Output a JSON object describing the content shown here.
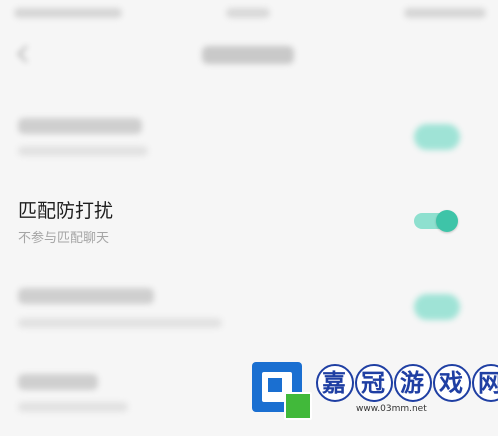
{
  "setting": {
    "title": "匹配防打扰",
    "subtitle": "不参与匹配聊天",
    "toggle_on": true
  },
  "colors": {
    "toggle_track": "#8ee0cf",
    "toggle_knob": "#3ec4a8",
    "background": "#f6f6f6"
  },
  "watermark": {
    "text": "嘉冠游戏网",
    "url": "www.03mm.net"
  }
}
